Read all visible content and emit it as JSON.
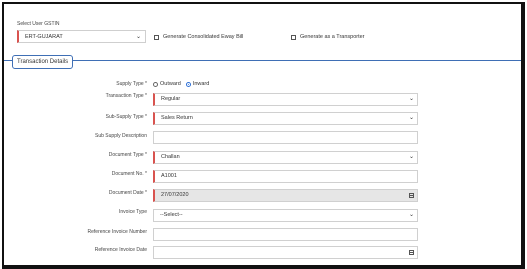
{
  "header": {
    "gstin_label": "Select User GSTIN",
    "gstin_value": "ERT-GUJARAT",
    "consolidated_label": "Generate Consolidated Eway Bill",
    "transporter_label": "Generate as a Transporter"
  },
  "section": {
    "tab_label": "Transaction Details"
  },
  "form": {
    "supply_type_label": "Supply Type *",
    "supply_outward": "Outward",
    "supply_inward": "Inward",
    "supply_selected": "Inward",
    "transaction_type_label": "Transaction Type *",
    "transaction_type_value": "Regular",
    "sub_supply_type_label": "Sub-Supply Type *",
    "sub_supply_type_value": "Sales Return",
    "sub_supply_desc_label": "Sub Supply Description",
    "sub_supply_desc_value": "",
    "document_type_label": "Document Type *",
    "document_type_value": "Challan",
    "document_no_label": "Document No. *",
    "document_no_value": "A1001",
    "document_date_label": "Document Date *",
    "document_date_value": "27/07/2020",
    "invoice_type_label": "Invoice Type",
    "invoice_type_value": "--Select--",
    "ref_invoice_number_label": "Reference Invoice Number",
    "ref_invoice_number_value": "",
    "ref_invoice_date_label": "Reference Invoice Date",
    "ref_invoice_date_value": ""
  },
  "icons": {
    "dropdown": "chevron-down-icon",
    "calendar": "calendar-icon"
  },
  "colors": {
    "required_marker": "#d9534f",
    "tab_border": "#3f6fb5",
    "radio_selected": "#2d6fd6"
  }
}
